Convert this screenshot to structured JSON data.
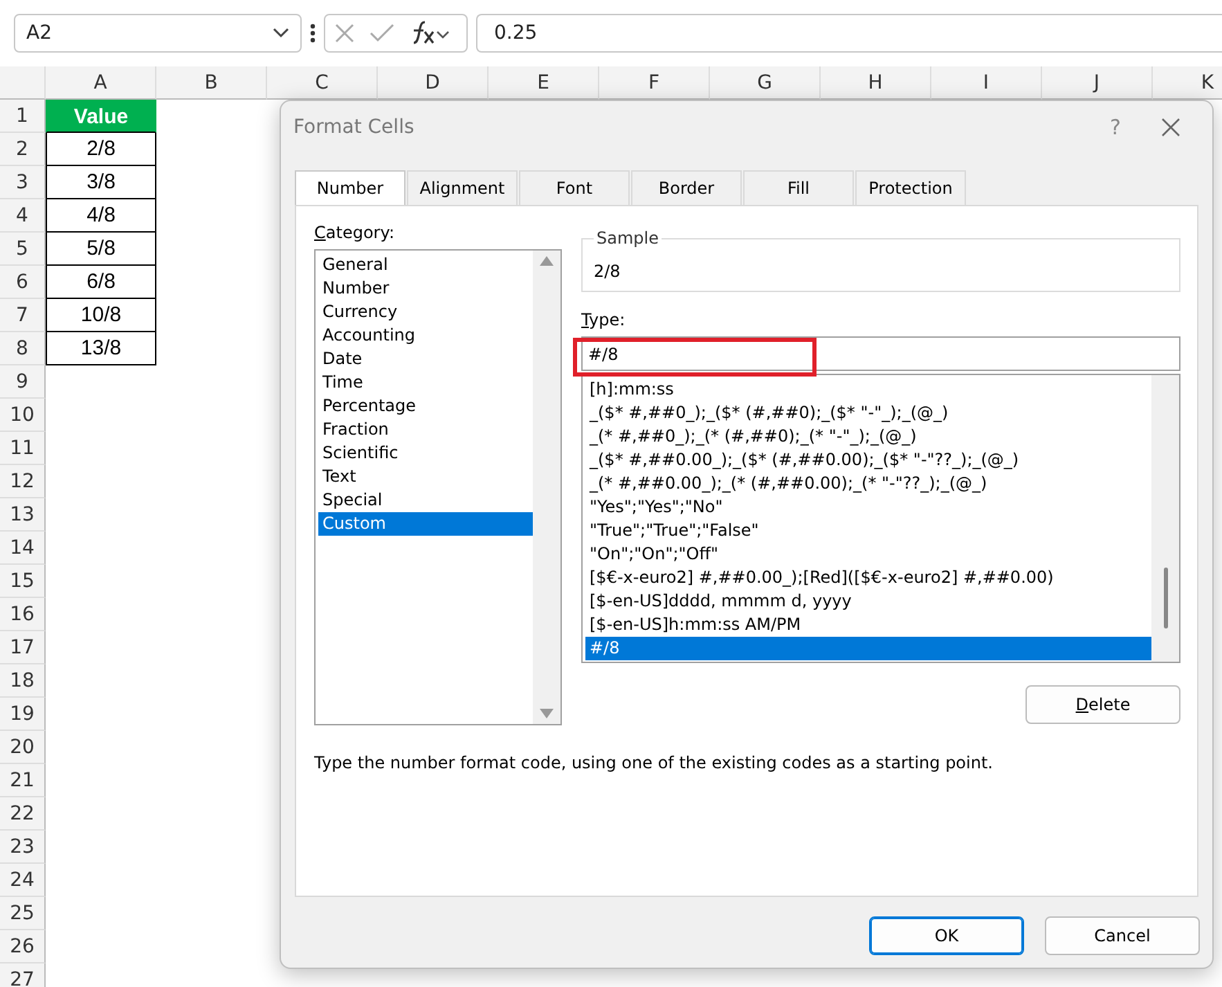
{
  "formula_bar": {
    "name_box": "A2",
    "formula": "0.25"
  },
  "sheet": {
    "columns": [
      "A",
      "B",
      "C",
      "D",
      "E",
      "F",
      "G",
      "H",
      "I",
      "J",
      "K"
    ],
    "rows": [
      "1",
      "2",
      "3",
      "4",
      "5",
      "6",
      "7",
      "8",
      "9",
      "10",
      "11",
      "12",
      "13",
      "14",
      "15",
      "16",
      "17",
      "18",
      "19",
      "20",
      "21",
      "22",
      "23",
      "24",
      "25",
      "26",
      "27"
    ],
    "cells": [
      {
        "text": "Value",
        "kind": "header"
      },
      {
        "text": "2/8",
        "kind": "value"
      },
      {
        "text": "3/8",
        "kind": "value"
      },
      {
        "text": "4/8",
        "kind": "value"
      },
      {
        "text": "5/8",
        "kind": "value"
      },
      {
        "text": "6/8",
        "kind": "value"
      },
      {
        "text": "10/8",
        "kind": "value"
      },
      {
        "text": "13/8",
        "kind": "value"
      }
    ]
  },
  "dialog": {
    "title": "Format Cells",
    "help": "?",
    "tabs": [
      {
        "label": "Number",
        "selected": true
      },
      {
        "label": "Alignment",
        "selected": false
      },
      {
        "label": "Font",
        "selected": false
      },
      {
        "label": "Border",
        "selected": false
      },
      {
        "label": "Fill",
        "selected": false
      },
      {
        "label": "Protection",
        "selected": false
      }
    ],
    "category_label": "Category:",
    "categories": [
      {
        "label": "General",
        "selected": false
      },
      {
        "label": "Number",
        "selected": false
      },
      {
        "label": "Currency",
        "selected": false
      },
      {
        "label": "Accounting",
        "selected": false
      },
      {
        "label": "Date",
        "selected": false
      },
      {
        "label": "Time",
        "selected": false
      },
      {
        "label": "Percentage",
        "selected": false
      },
      {
        "label": "Fraction",
        "selected": false
      },
      {
        "label": "Scientific",
        "selected": false
      },
      {
        "label": "Text",
        "selected": false
      },
      {
        "label": "Special",
        "selected": false
      },
      {
        "label": "Custom",
        "selected": true
      }
    ],
    "sample": {
      "label": "Sample",
      "value": "2/8"
    },
    "type_label": "Type:",
    "type_value": "#/8",
    "type_highlighted": true,
    "formats": [
      {
        "label": "[h]:mm:ss",
        "selected": false
      },
      {
        "label": "_($* #,##0_);_($* (#,##0);_($* \"-\"_);_(@_)",
        "selected": false
      },
      {
        "label": "_(* #,##0_);_(* (#,##0);_(* \"-\"_);_(@_)",
        "selected": false
      },
      {
        "label": "_($* #,##0.00_);_($* (#,##0.00);_($* \"-\"??_);_(@_)",
        "selected": false
      },
      {
        "label": "_(* #,##0.00_);_(* (#,##0.00);_(* \"-\"??_);_(@_)",
        "selected": false
      },
      {
        "label": "\"Yes\";\"Yes\";\"No\"",
        "selected": false
      },
      {
        "label": "\"True\";\"True\";\"False\"",
        "selected": false
      },
      {
        "label": "\"On\";\"On\";\"Off\"",
        "selected": false
      },
      {
        "label": "[$€-x-euro2] #,##0.00_);[Red]([$€-x-euro2] #,##0.00)",
        "selected": false
      },
      {
        "label": "[$-en-US]dddd, mmmm d, yyyy",
        "selected": false
      },
      {
        "label": "[$-en-US]h:mm:ss AM/PM",
        "selected": false
      },
      {
        "label": "#/8",
        "selected": true
      }
    ],
    "delete_button": "Delete",
    "description": "Type the number format code, using one of the existing codes as a starting point.",
    "buttons": [
      {
        "label": "OK",
        "default": true
      },
      {
        "label": "Cancel",
        "default": false
      }
    ]
  }
}
